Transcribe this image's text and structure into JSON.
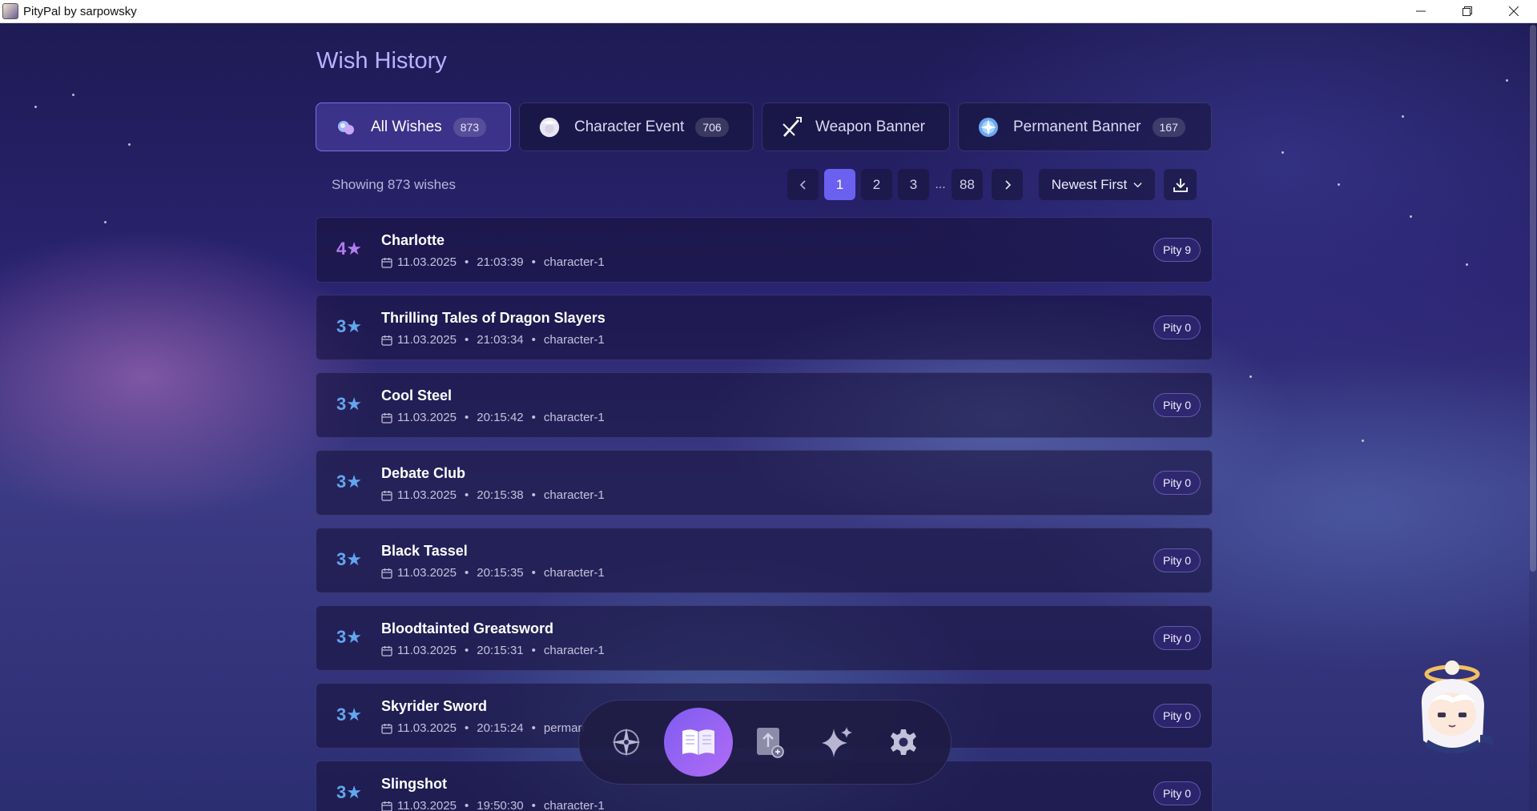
{
  "window": {
    "title": "PityPal by sarpowsky"
  },
  "page": {
    "title": "Wish History"
  },
  "tabs": [
    {
      "label": "All Wishes",
      "count": "873",
      "icon": "all-wishes-icon",
      "active": true
    },
    {
      "label": "Character Event",
      "count": "706",
      "icon": "character-event-icon",
      "active": false
    },
    {
      "label": "Weapon Banner",
      "count": "",
      "icon": "weapon-banner-icon",
      "active": false
    },
    {
      "label": "Permanent Banner",
      "count": "167",
      "icon": "permanent-banner-icon",
      "active": false
    }
  ],
  "toolbar": {
    "showing": "Showing 873 wishes",
    "pages": [
      "1",
      "2",
      "3"
    ],
    "ellipsis": "...",
    "last_page": "88",
    "current_page": "1",
    "sort_label": "Newest First"
  },
  "wishes": [
    {
      "rarity": "4★",
      "name": "Charlotte",
      "date": "11.03.2025",
      "time": "21:03:39",
      "banner": "character-1",
      "pity": "Pity 9"
    },
    {
      "rarity": "3★",
      "name": "Thrilling Tales of Dragon Slayers",
      "date": "11.03.2025",
      "time": "21:03:34",
      "banner": "character-1",
      "pity": "Pity 0"
    },
    {
      "rarity": "3★",
      "name": "Cool Steel",
      "date": "11.03.2025",
      "time": "20:15:42",
      "banner": "character-1",
      "pity": "Pity 0"
    },
    {
      "rarity": "3★",
      "name": "Debate Club",
      "date": "11.03.2025",
      "time": "20:15:38",
      "banner": "character-1",
      "pity": "Pity 0"
    },
    {
      "rarity": "3★",
      "name": "Black Tassel",
      "date": "11.03.2025",
      "time": "20:15:35",
      "banner": "character-1",
      "pity": "Pity 0"
    },
    {
      "rarity": "3★",
      "name": "Bloodtainted Greatsword",
      "date": "11.03.2025",
      "time": "20:15:31",
      "banner": "character-1",
      "pity": "Pity 0"
    },
    {
      "rarity": "3★",
      "name": "Skyrider Sword",
      "date": "11.03.2025",
      "time": "20:15:24",
      "banner": "perman",
      "pity": "Pity 0"
    },
    {
      "rarity": "3★",
      "name": "Slingshot",
      "date": "11.03.2025",
      "time": "19:50:30",
      "banner": "character-1",
      "pity": "Pity 0"
    }
  ],
  "dock": [
    {
      "icon": "compass-icon",
      "active": false
    },
    {
      "icon": "book-icon",
      "active": true
    },
    {
      "icon": "banner-upload-icon",
      "active": false
    },
    {
      "icon": "sparkles-icon",
      "active": false
    },
    {
      "icon": "settings-icon",
      "active": false
    }
  ],
  "colors": {
    "accent": "#6a61f0",
    "four_star": "#b57cf0",
    "three_star": "#63a6ee"
  }
}
